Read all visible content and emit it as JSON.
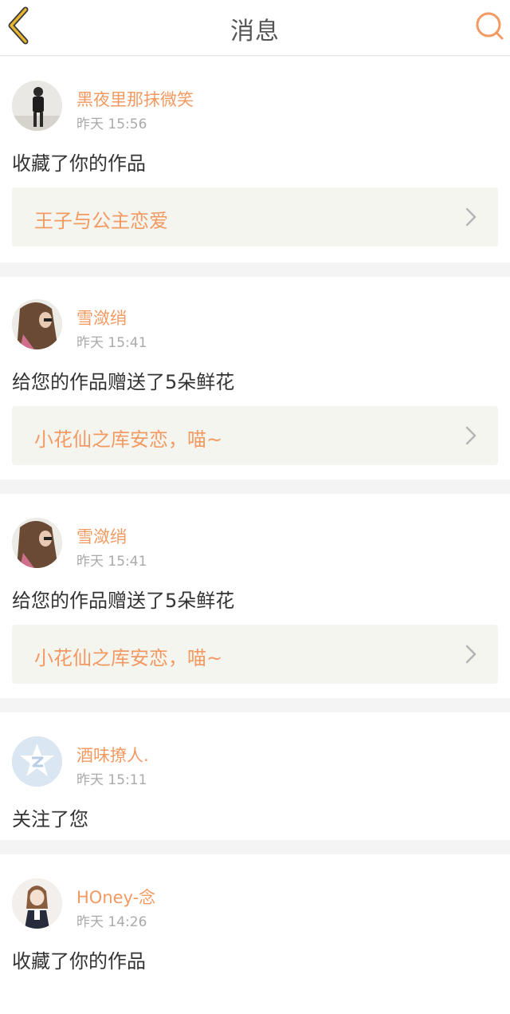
{
  "header": {
    "title": "消息"
  },
  "notifications": [
    {
      "username": "黑夜里那抹微笑",
      "time": "昨天 15:56",
      "action": "收藏了你的作品",
      "work_title": "王子与公主恋爱"
    },
    {
      "username": "雪潋绡",
      "time": "昨天 15:41",
      "action": "给您的作品赠送了5朵鲜花",
      "work_title": "小花仙之库安恋，喵~"
    },
    {
      "username": "雪潋绡",
      "time": "昨天 15:41",
      "action": "给您的作品赠送了5朵鲜花",
      "work_title": "小花仙之库安恋，喵~"
    },
    {
      "username": "酒味撩人.",
      "time": "昨天 15:11",
      "action": "关注了您"
    },
    {
      "username": "HOney-念",
      "time": "昨天 14:26",
      "action": "收藏了你的作品"
    }
  ],
  "colors": {
    "accent": "#f29a62",
    "back_icon": "#e8b531"
  },
  "icons": {
    "back": "back-arrow-icon",
    "search": "search-icon",
    "chevron": "chevron-right-icon"
  }
}
